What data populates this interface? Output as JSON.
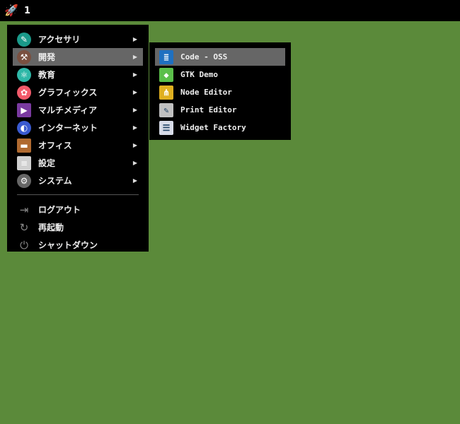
{
  "topbar": {
    "workspace": "1"
  },
  "menu": {
    "items": [
      {
        "label": "アクセサリ",
        "icon": "accessories-icon",
        "color": "#1a9a8a"
      },
      {
        "label": "開発",
        "icon": "hammer-icon",
        "color": "#7a5040"
      },
      {
        "label": "教育",
        "icon": "education-icon",
        "color": "#2fb8a8"
      },
      {
        "label": "グラフィックス",
        "icon": "graphics-icon",
        "color": "#f25a6a"
      },
      {
        "label": "マルチメディア",
        "icon": "multimedia-icon",
        "color": "#7a3aa0"
      },
      {
        "label": "インターネット",
        "icon": "internet-icon",
        "color": "#3a5ad0"
      },
      {
        "label": "オフィス",
        "icon": "briefcase-icon",
        "color": "#b06a30"
      },
      {
        "label": "設定",
        "icon": "settings-icon",
        "color": "#d0d0d0"
      },
      {
        "label": "システム",
        "icon": "gear-icon",
        "color": "#666"
      }
    ],
    "actions": [
      {
        "label": "ログアウト",
        "icon": "logout-icon"
      },
      {
        "label": "再起動",
        "icon": "restart-icon"
      },
      {
        "label": "シャットダウン",
        "icon": "power-icon"
      }
    ]
  },
  "submenu": {
    "items": [
      {
        "label": "Code - OSS",
        "icon": "vscode-icon",
        "color": "#1f70c0"
      },
      {
        "label": "GTK Demo",
        "icon": "gtk-cube-icon",
        "color": "#5bbf4a"
      },
      {
        "label": "Node Editor",
        "icon": "node-editor-icon",
        "color": "#e0b020"
      },
      {
        "label": "Print Editor",
        "icon": "print-editor-icon",
        "color": "#c0c0c0"
      },
      {
        "label": "Widget Factory",
        "icon": "widget-factory-icon",
        "color": "#d8dce8"
      }
    ]
  }
}
